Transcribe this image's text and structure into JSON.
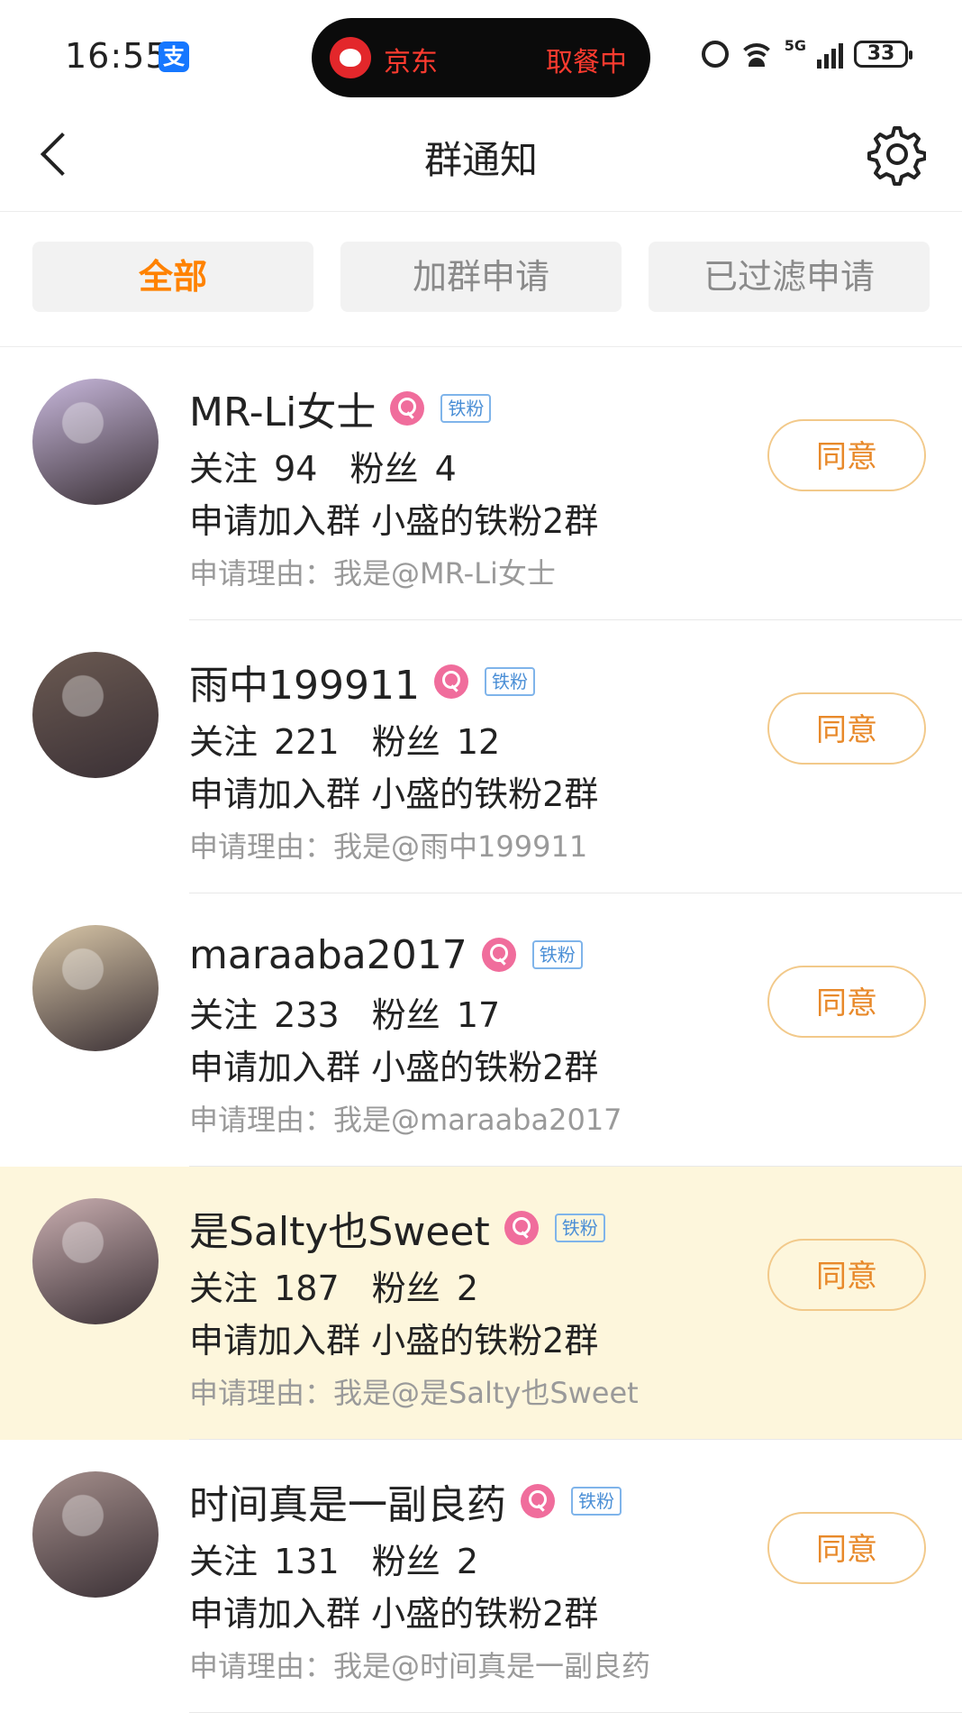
{
  "status_bar": {
    "time": "16:55",
    "alipay_badge": "支",
    "live_activity": {
      "app": "京东",
      "status": "取餐中"
    },
    "network": "5G",
    "battery": "33"
  },
  "nav": {
    "title": "群通知"
  },
  "tabs": [
    {
      "label": "全部",
      "active": true
    },
    {
      "label": "加群申请",
      "active": false
    },
    {
      "label": "已过滤申请",
      "active": false
    }
  ],
  "labels": {
    "follow": "关注",
    "fans": "粉丝",
    "apply_group_prefix": "申请加入群",
    "reason_prefix": "申请理由：",
    "agree": "同意",
    "fan_badge": "铁粉"
  },
  "requests": [
    {
      "name": "MR-Li女士",
      "follow": "94",
      "fans": "4",
      "group": "小盛的铁粉2群",
      "reason": "我是@MR-Li女士",
      "highlight": false,
      "avatar_color": "#c8b8dc"
    },
    {
      "name": "雨中199911",
      "follow": "221",
      "fans": "12",
      "group": "小盛的铁粉2群",
      "reason": "我是@雨中199911",
      "highlight": false,
      "avatar_color": "#6b5a52"
    },
    {
      "name": "maraaba2017",
      "follow": "233",
      "fans": "17",
      "group": "小盛的铁粉2群",
      "reason": "我是@maraaba2017",
      "highlight": false,
      "avatar_color": "#d9c7a8"
    },
    {
      "name": "是Salty也Sweet",
      "follow": "187",
      "fans": "2",
      "group": "小盛的铁粉2群",
      "reason": "我是@是Salty也Sweet",
      "highlight": true,
      "avatar_color": "#c9aeb0"
    },
    {
      "name": "时间真是一副良药",
      "follow": "131",
      "fans": "2",
      "group": "小盛的铁粉2群",
      "reason": "我是@时间真是一副良药",
      "highlight": false,
      "avatar_color": "#a58f8c"
    }
  ]
}
